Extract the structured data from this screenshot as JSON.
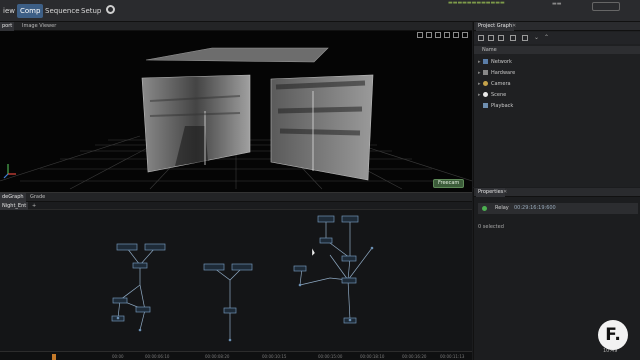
{
  "menu": {
    "items": [
      "iew",
      "Comp",
      "Sequence",
      "Setup"
    ],
    "active_index": 1
  },
  "viewport": {
    "tabs": [
      "port",
      "Image Viewer"
    ],
    "freecam_label": "Freecam"
  },
  "project_graph": {
    "tab_title": "Project Graph",
    "column_header": "Name",
    "items": [
      {
        "label": "Network",
        "icon": "network-icon"
      },
      {
        "label": "Hardware",
        "icon": "hardware-icon"
      },
      {
        "label": "Camera",
        "icon": "camera-icon"
      },
      {
        "label": "Scene",
        "icon": "scene-icon"
      },
      {
        "label": "Playback",
        "icon": "playback-icon"
      }
    ]
  },
  "properties": {
    "tab_title": "Properties",
    "row_key": "Relay",
    "row_value": "00:29:16:19:600",
    "selected_text": "0 selected"
  },
  "node_graph": {
    "tabs": [
      "deGraph",
      "Grade"
    ],
    "subtab": "Night_Ent"
  },
  "timeline": {
    "codes": [
      "00:00",
      "00:00:06:10",
      "00:00:08:20",
      "00:00:10:15",
      "00:00:15:00",
      "00:00:18:10",
      "00:00:16:20",
      "00:00:11:13"
    ],
    "time_display": "10:49"
  },
  "watermark_text": "F.",
  "colors": {
    "accent": "#3d5f86",
    "freecam_bg": "#3c5c3a",
    "status_green": "#4caf50"
  }
}
